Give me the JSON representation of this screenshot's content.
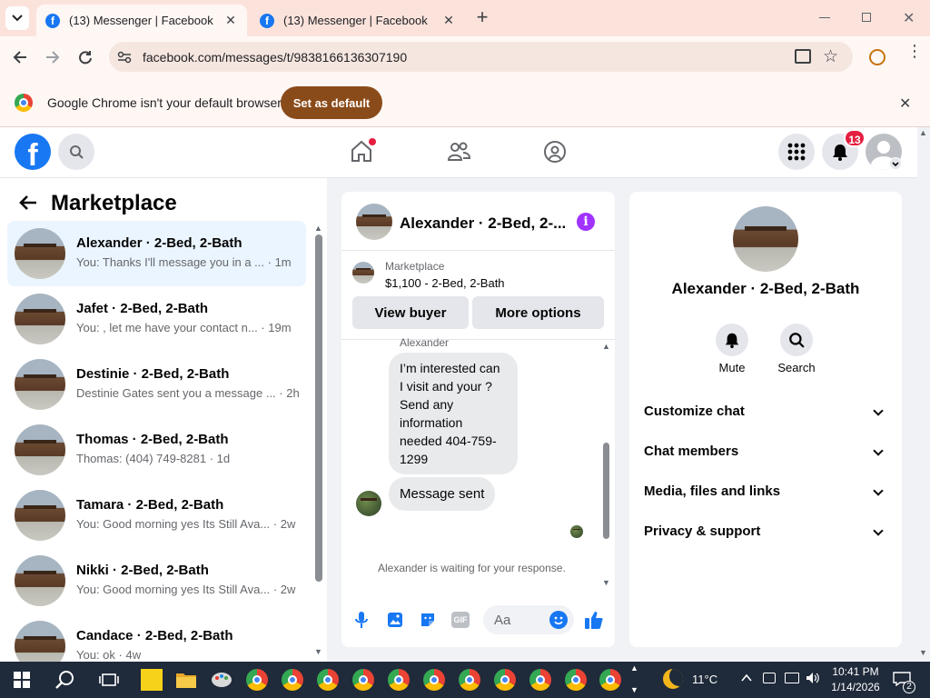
{
  "browser": {
    "tabs": [
      {
        "title": "(13) Messenger | Facebook",
        "active": true
      },
      {
        "title": "(13) Messenger | Facebook",
        "active": false
      }
    ],
    "url": "facebook.com/messages/t/9838166136307190",
    "infobar": {
      "message": "Google Chrome isn't your default browser",
      "button": "Set as default"
    }
  },
  "header": {
    "notifications_count": "13"
  },
  "sidebar": {
    "title": "Marketplace",
    "conversations": [
      {
        "name": "Alexander · 2-Bed, 2-Bath",
        "snippet": "You: Thanks I'll message you in a ...",
        "time": "· 1m",
        "selected": true
      },
      {
        "name": "Jafet · 2-Bed, 2-Bath",
        "snippet": "You: , let me have your contact n...",
        "time": "· 19m"
      },
      {
        "name": "Destinie · 2-Bed, 2-Bath",
        "snippet": "Destinie Gates sent you a message ...",
        "time": "· 2h"
      },
      {
        "name": "Thomas · 2-Bed, 2-Bath",
        "snippet": "Thomas: (404) 749-8281",
        "time": "· 1d"
      },
      {
        "name": "Tamara · 2-Bed, 2-Bath",
        "snippet": "You: Good morning yes Its Still Ava...",
        "time": "· 2w"
      },
      {
        "name": "Nikki · 2-Bed, 2-Bath",
        "snippet": "You: Good morning yes Its Still Ava...",
        "time": "· 2w"
      },
      {
        "name": "Candace · 2-Bed, 2-Bath",
        "snippet": "You: ok",
        "time": "· 4w"
      }
    ]
  },
  "chat": {
    "title": "Alexander · 2-Bed, 2-...",
    "listing": {
      "source": "Marketplace",
      "detail": "$1,100 - 2-Bed, 2-Bath"
    },
    "view_buyer": "View buyer",
    "more_options": "More options",
    "sender_label": "Alexander",
    "messages": [
      {
        "text": "I’m interested can I visit and your ? Send any information needed 404-759-1299"
      },
      {
        "text": "Message sent"
      }
    ],
    "waiting": "Alexander is waiting for your response.",
    "composer_placeholder": "Aa"
  },
  "info_panel": {
    "name": "Alexander · 2-Bed, 2-Bath",
    "mute": "Mute",
    "search": "Search",
    "sections": [
      "Customize chat",
      "Chat members",
      "Media, files and links",
      "Privacy & support"
    ]
  },
  "taskbar": {
    "weather": "11°C",
    "time": "10:41 PM",
    "date": "1/14/2026",
    "notification_count": "2"
  },
  "colors": {
    "fb_blue": "#1877f2",
    "purple_info": "#a033ff",
    "notif_red": "#e41e3f",
    "infobar_button": "#8a4b1a"
  }
}
